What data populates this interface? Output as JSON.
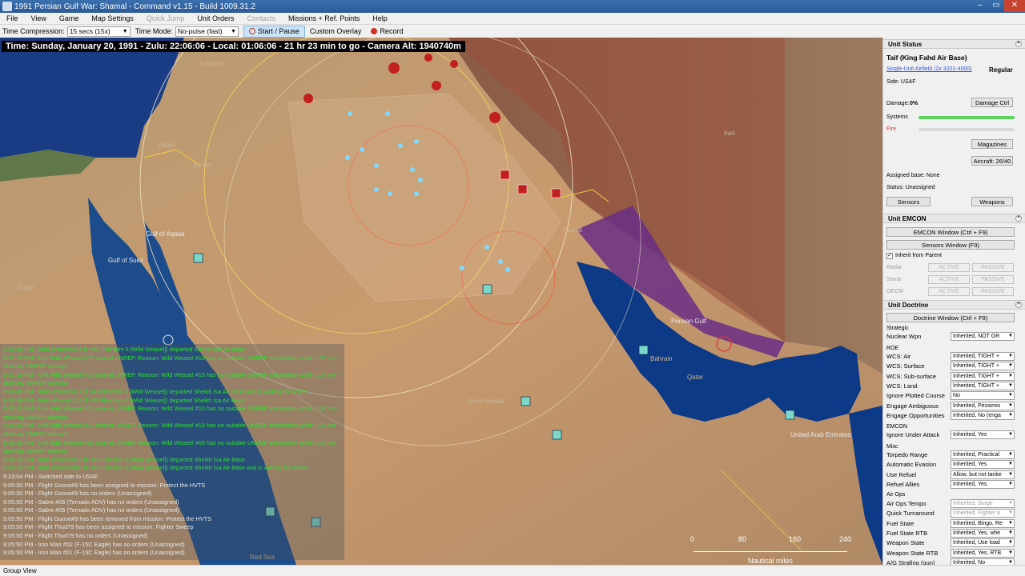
{
  "window": {
    "title": "1991 Persian Gulf War: Shamal - Command v1.15 - Build 1009.31.2",
    "min": "–",
    "max": "▭",
    "close": "✕"
  },
  "menu": [
    {
      "label": "File",
      "enabled": true
    },
    {
      "label": "View",
      "enabled": true
    },
    {
      "label": "Game",
      "enabled": true
    },
    {
      "label": "Map Settings",
      "enabled": true
    },
    {
      "label": "Quick Jump",
      "enabled": false
    },
    {
      "label": "Unit Orders",
      "enabled": true
    },
    {
      "label": "Contacts",
      "enabled": false
    },
    {
      "label": "Missions + Ref. Points",
      "enabled": true
    },
    {
      "label": "Help",
      "enabled": true
    }
  ],
  "toolbar": {
    "time_compression_label": "Time Compression:",
    "time_compression_value": "15 secs (15x)",
    "time_mode_label": "Time Mode:",
    "time_mode_value": "No-pulse (fast)",
    "start_pause": "Start / Pause",
    "custom_overlay": "Custom Overlay",
    "record": "Record"
  },
  "map": {
    "time_text": "Time: Sunday, January 20, 1991 - Zulu: 22:06:06 - Local: 01:06:06 - 21 hr 23 min to go - Camera Alt: 1940740m",
    "labels": {
      "persian_gulf": "Persian Gulf",
      "south_arabia": "South Arabia",
      "uae": "United Arab Emirates",
      "gulf_aqaba": "Gulf of Aqaba",
      "gulf_suez": "Gulf of Suez",
      "iran": "Iran",
      "israel": "Israel",
      "jordan": "Jordan",
      "lebanon": "Lebanon",
      "qatar": "Qatar",
      "bahrain": "Bahrain",
      "egypt": "Egypt",
      "red_sea": "Red Sea",
      "kuwait": "Kuwait"
    },
    "scale": {
      "ticks": [
        "0",
        "80",
        "160",
        "240"
      ],
      "unit": "Nautical miles"
    },
    "messages": [
      {
        "t": "9:32:58 PM - Wild Weasel #16 (F-4G Phantom II [Wild Weasel]) departed Sheikh Isa Air Base",
        "c": "g"
      },
      {
        "t": "9:31:15 PM - Unit Wild Weasel #15 cannot UNREP. Reason: Wild Weasel #16 has no suitable UNREP destination within 100 nm -",
        "c": "g"
      },
      {
        "t": "aborting UNREP attempt",
        "c": "g"
      },
      {
        "t": "9:31:15 PM - Unit Wild Weasel #15 cannot UNREP. Reason: Wild Weasel #15 has no suitable UNREP destination within 100 nm -",
        "c": "g"
      },
      {
        "t": "aborting UNREP attempt",
        "c": "g"
      },
      {
        "t": "9:30:49 PM - Wild Weasel #11 (F-4G Phantom II [Wild Weasel]) departed Sheikh Isa Air Base and is waiting for orders",
        "c": "g"
      },
      {
        "t": "9:30:49 PM - Wild Weasel #11 (F-4G Phantom II [Wild Weasel]) departed Sheikh Isa Air Base",
        "c": "g"
      },
      {
        "t": "9:30:32 PM - Unit Wild Weasel #10 cannot UNREP. Reason: Wild Weasel #10 has no suitable UNREP destination within 100 nm -",
        "c": "g"
      },
      {
        "t": "aborting UNREP attempt",
        "c": "g"
      },
      {
        "t": "9:30:32 PM - Unit Wild Weasel #10 cannot UNREP. Reason: Wild Weasel #10 has no suitable UNREP destination within 100 nm -",
        "c": "g"
      },
      {
        "t": "aborting UNREP attempt",
        "c": "g"
      },
      {
        "t": "9:30:32 PM - Unit Wild Weasel #09 cannot UNREP. Reason: Wild Weasel #09 has no suitable UNREP destination within 100 nm -",
        "c": "g"
      },
      {
        "t": "aborting UNREP attempt",
        "c": "g"
      },
      {
        "t": "9:30:19 PM - Wild Weasel #10 (F-4G Phantom II [Wild Weasel]) departed Sheikh Isa Air Base",
        "c": "g"
      },
      {
        "t": "9:30:19 PM - Wild Weasel #09 (F-4G Phantom II [Wild Weasel]) departed Sheikh Isa Air Base and is waiting for orders",
        "c": "g"
      },
      {
        "t": "9:23:04 PM - Switched side to USAF",
        "c": "w"
      },
      {
        "t": "9:05:50 PM - Flight Goose#9 has been assigned to mission: Protect the HVTS",
        "c": "w"
      },
      {
        "t": "9:05:50 PM - Flight Goose#9 has no orders (Unassigned)",
        "c": "w"
      },
      {
        "t": "9:05:50 PM - Sabre #06 (Tornado ADV) has no orders (Unassigned)",
        "c": "w"
      },
      {
        "t": "9:05:50 PM - Sabre #05 (Tornado ADV) has no orders (Unassigned)",
        "c": "w"
      },
      {
        "t": "9:05:50 PM - Flight Goose#9 has been removed from mission: Protect the HVTS",
        "c": "w"
      },
      {
        "t": "9:05:50 PM - Flight Thud79 has been assigned to mission: Fighter Sweep",
        "c": "w"
      },
      {
        "t": "9:05:50 PM - Flight Thud79 has no orders (Unassigned)",
        "c": "w"
      },
      {
        "t": "9:05:50 PM - Iron Man #02 (F-15C Eagle) has no orders (Unassigned)",
        "c": "w"
      },
      {
        "t": "9:05:50 PM - Iron Man #01 (F-15C Eagle) has no orders (Unassigned)",
        "c": "w"
      }
    ]
  },
  "panel": {
    "unit_status_header": "Unit Status",
    "unit_name": "Taif (King Fahd Air Base)",
    "unit_class": "Single-Unit Airfield (2x 3201-4000)",
    "proficiency": "Regular",
    "side": "Side: USAF",
    "damage_label": "Damage:",
    "damage_value": "0%",
    "damage_ctrl": "Damage Ctrl",
    "systems": "Systems",
    "fire": "Fire",
    "magazines": "Magazines",
    "aircraft": "Aircraft: 26/40",
    "assigned_base": "Assigned base: None",
    "status": "Status: Unassigned",
    "sensors": "Sensors",
    "weapons": "Weapons",
    "emcon_header": "Unit EMCON",
    "emcon_window": "EMCON Window (Ctrl + F9)",
    "sensors_window": "Sensors Window (F9)",
    "inherit": "Inherit from Parent",
    "emcon_rows": [
      {
        "k": "Radar",
        "a": "ACTIVE",
        "p": "PASSIVE"
      },
      {
        "k": "Sonar",
        "a": "ACTIVE",
        "p": "PASSIVE"
      },
      {
        "k": "OECM",
        "a": "ACTIVE",
        "p": "PASSIVE"
      }
    ],
    "doctrine_header": "Unit Doctrine",
    "doctrine_window": "Doctrine Window (Ctrl + F9)",
    "strategic": "Strategic",
    "nuclear_label": "Nuclear Wpn",
    "nuclear_value": "Inherited, NOT GR",
    "roe": "ROE",
    "roe_rows": [
      {
        "k": "WCS: Air",
        "v": "Inherited, TIGHT +"
      },
      {
        "k": "WCS: Surface",
        "v": "Inherited, TIGHT +"
      },
      {
        "k": "WCS: Sub-surface",
        "v": "Inherited, TIGHT +"
      },
      {
        "k": "WCS: Land",
        "v": "Inherited, TIGHT +"
      },
      {
        "k": "Ignore Plotted Course",
        "v": "No"
      },
      {
        "k": "Engage Ambiguous",
        "v": "Inherited, Pessimis"
      },
      {
        "k": "Engage Opportunities",
        "v": "Inherited, No (enga"
      }
    ],
    "emcon2": "EMCON",
    "ignore_attack_label": "Ignore Under Attack",
    "ignore_attack_value": "Inherited, Yes",
    "misc": "Misc",
    "misc_rows": [
      {
        "k": "Torpedo Range",
        "v": "Inherited, Practical"
      },
      {
        "k": "Automatic Evasion",
        "v": "Inherited, Yes"
      },
      {
        "k": "Use Refuel",
        "v": "Allow, but not tanke"
      },
      {
        "k": "Refuel Allies",
        "v": "Inherited, Yes"
      }
    ],
    "airops": "Air Ops",
    "airops_rows": [
      {
        "k": "Air Ops Tempo",
        "v": "Inherited, Surge",
        "dis": true
      },
      {
        "k": "Quick Turnaround",
        "v": "Inherited, Fighter a",
        "dis": true
      },
      {
        "k": "Fuel State",
        "v": "Inherited, Bingo, Re"
      },
      {
        "k": "Fuel State RTB",
        "v": "Inherited, Yes, whe"
      },
      {
        "k": "Weapon State",
        "v": "Inherited, Use load"
      },
      {
        "k": "Weapon State RTB",
        "v": "Inherited, Yes, RTB"
      },
      {
        "k": "A/G Strafing (gun)",
        "v": "Inherited, No"
      },
      {
        "k": "Jettison Ordnance",
        "v": "Inherited, Yes"
      }
    ]
  },
  "statusbar": {
    "text": "Group View"
  },
  "colors": {
    "log_green": "#2fe02f",
    "hostile": "#cc1f1f",
    "friendly_air": "#7fd8ff",
    "sea": "#0c3a86"
  }
}
